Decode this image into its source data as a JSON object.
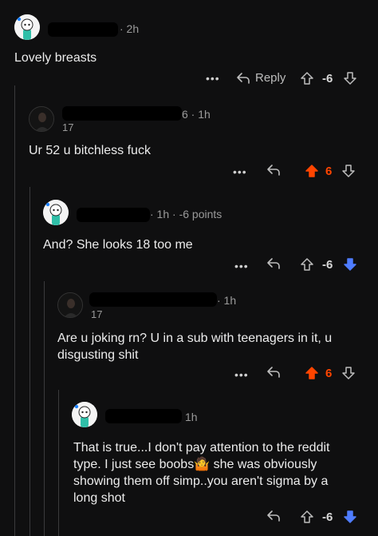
{
  "comments": [
    {
      "avatar": "snoo-avatar",
      "meta": "· 2h",
      "body": [
        "Lovely breasts"
      ],
      "actions": {
        "more": "•••",
        "reply_label": "Reply",
        "score": "-6",
        "vote_state": "none"
      }
    },
    {
      "avatar": "dark-avatar",
      "meta": "6 · 1h",
      "age_badge": "17",
      "body": [
        "Ur 52 u bitchless fuck"
      ],
      "actions": {
        "more": "•••",
        "score": "6",
        "vote_state": "upvoted"
      }
    },
    {
      "avatar": "snoo-avatar",
      "meta": "· 1h · -6 points",
      "body": [
        "And? She looks 18 too me"
      ],
      "actions": {
        "more": "•••",
        "score": "-6",
        "vote_state": "downvoted"
      }
    },
    {
      "avatar": "dark-avatar",
      "meta": "· 1h",
      "age_badge": "17",
      "body": [
        "Are u joking rn? U in a sub with teenagers in it, u",
        "disgusting shit"
      ],
      "actions": {
        "more": "•••",
        "score": "6",
        "vote_state": "upvoted"
      }
    },
    {
      "avatar": "snoo-avatar",
      "meta": "1h",
      "body": [
        "That is true...I don't pay attention to the reddit",
        "type. I just see boobs🤷 she was obviously",
        "showing them off simp..you aren't sigma by a",
        "long shot"
      ],
      "actions": {
        "score": "-6",
        "vote_state": "downvoted"
      }
    }
  ],
  "colors": {
    "background": "#0f0f10",
    "upvote": "#ff4500",
    "downvote": "#4f7dff",
    "thread_line": "#3a3a3c"
  }
}
